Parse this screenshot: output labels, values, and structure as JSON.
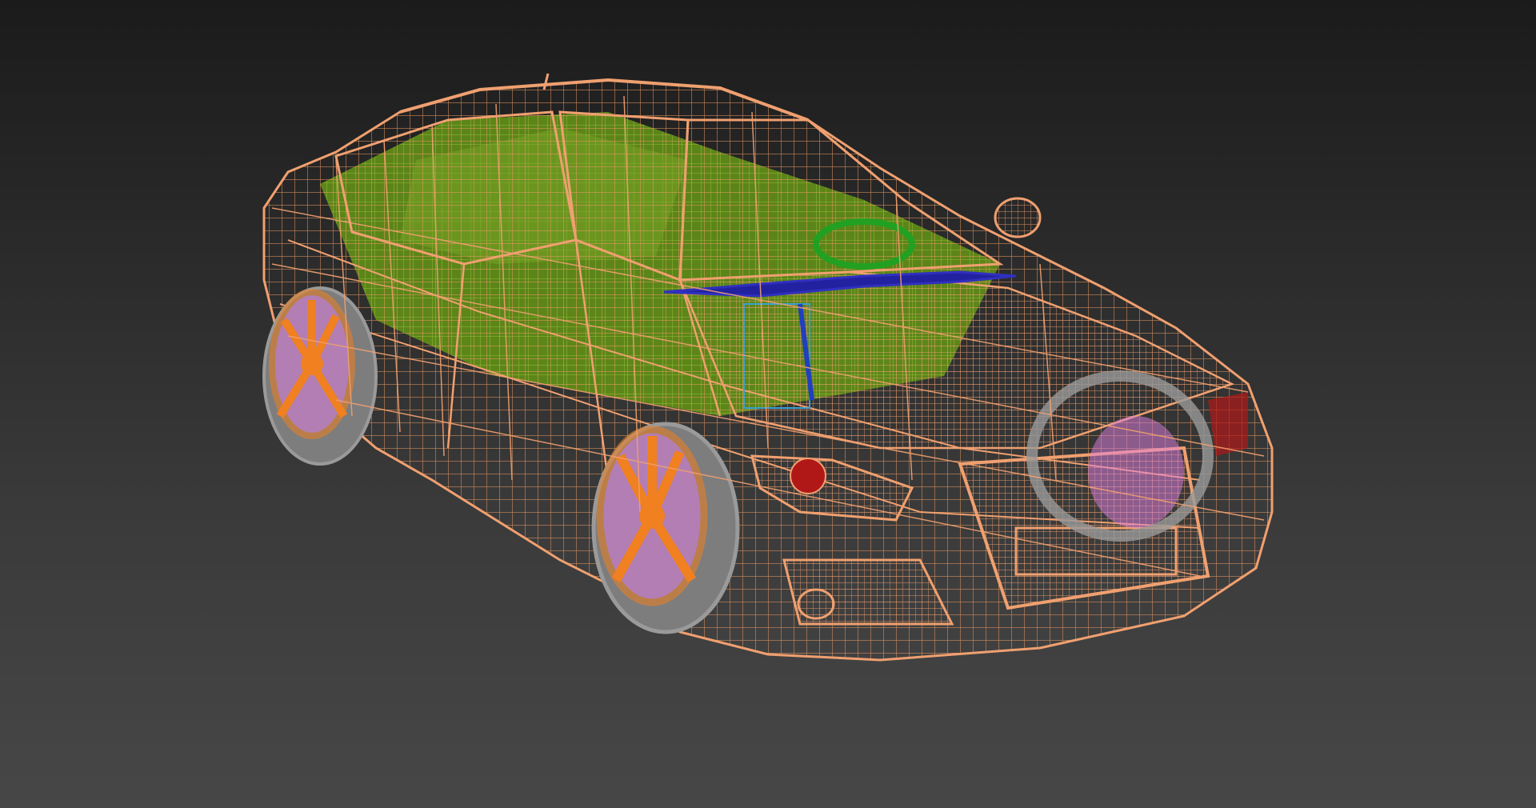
{
  "viewport": {
    "shading_mode": "wireframe",
    "background_top": "#1b1b1b",
    "background_bottom": "#474747"
  },
  "scene": {
    "object": "sedan car model",
    "colors": {
      "body_wire": "#f0a070",
      "interior_wire": "#6f9a1e",
      "interior_highlight": "#8cc020",
      "dashboard_bar": "#20209a",
      "steering_wheel": "#20a020",
      "rim": "#f08020",
      "tire": "#909090",
      "brake_disc": "#e080e0",
      "tail_light": "#b01818"
    }
  }
}
